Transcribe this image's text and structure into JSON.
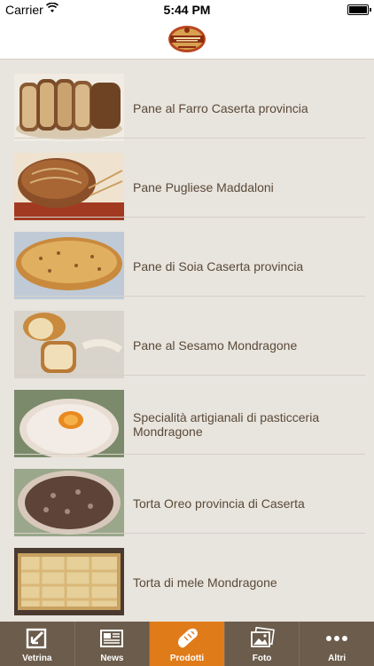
{
  "status_bar": {
    "carrier": "Carrier",
    "time": "5:44 PM"
  },
  "header": {
    "logo_icon": "bakery-logo-icon"
  },
  "products": [
    {
      "name": "Pane al Farro Caserta provincia",
      "thumb": "bread-slices-photo"
    },
    {
      "name": "Pane Pugliese Maddaloni",
      "thumb": "round-loaf-photo"
    },
    {
      "name": "Pane di Soia Caserta provincia",
      "thumb": "soy-bread-photo"
    },
    {
      "name": "Pane al Sesamo Mondragone",
      "thumb": "sesame-bread-photo"
    },
    {
      "name": "Specialità artigianali di pasticceria Mondragone",
      "thumb": "pastry-photo"
    },
    {
      "name": "Torta Oreo provincia di Caserta",
      "thumb": "oreo-cake-photo"
    },
    {
      "name": "Torta di mele Mondragone",
      "thumb": "apple-cake-photo"
    }
  ],
  "tabs": [
    {
      "label": "Vetrina",
      "icon": "showcase-icon",
      "active": false
    },
    {
      "label": "News",
      "icon": "news-icon",
      "active": false
    },
    {
      "label": "Prodotti",
      "icon": "bread-icon",
      "active": true
    },
    {
      "label": "Foto",
      "icon": "photos-icon",
      "active": false
    },
    {
      "label": "Altri",
      "icon": "more-icon",
      "active": false
    }
  ],
  "colors": {
    "accent": "#e07b1a",
    "tabbar": "#6b5c4c",
    "background": "#e8e4de",
    "text": "#5a4a38"
  }
}
